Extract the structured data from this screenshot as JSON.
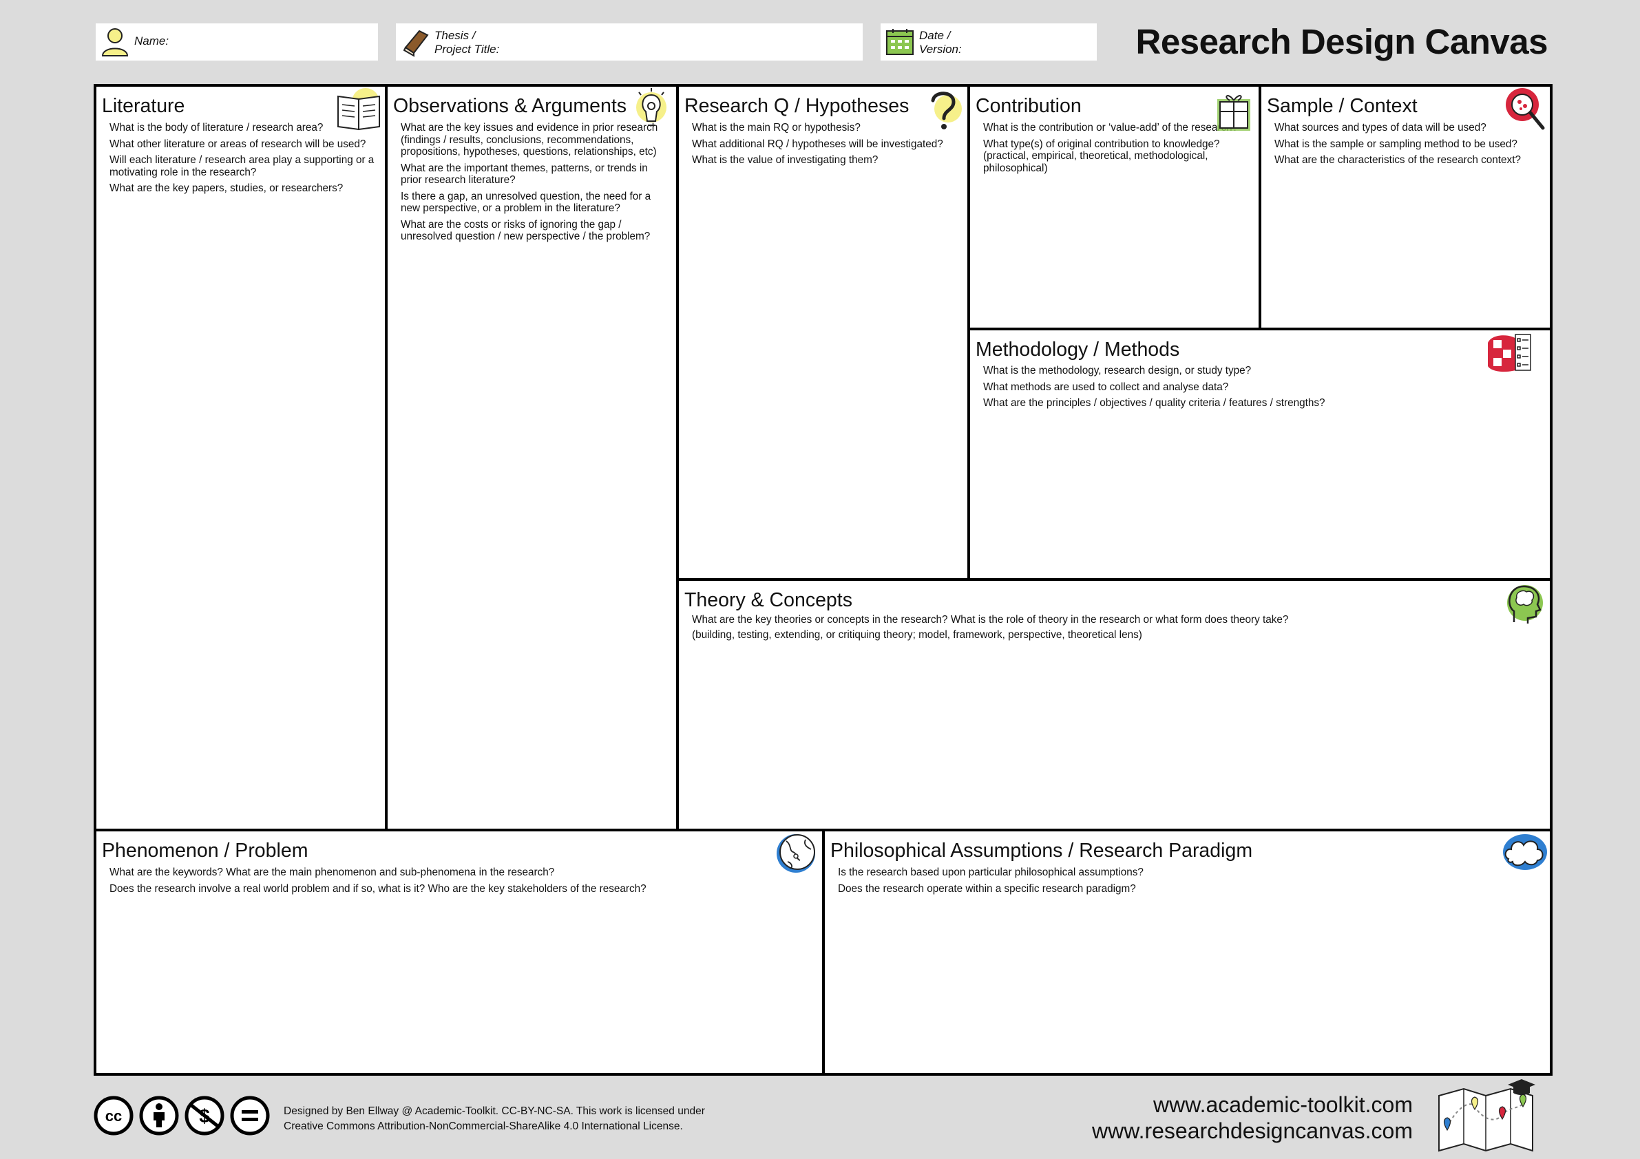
{
  "header": {
    "name_label": "Name:",
    "thesis_label": "Thesis /\nProject Title:",
    "date_label": "Date /\nVersion:",
    "title": "Research Design Canvas"
  },
  "sections": {
    "literature": {
      "title": "Literature",
      "icon": "book-icon",
      "questions": [
        "What is the body of literature / research area?",
        "What other literature or areas of research will be used?",
        "Will each literature / research area play a supporting or a motivating role in the research?",
        "What are the key papers, studies, or researchers?"
      ]
    },
    "observations": {
      "title": "Observations & Arguments",
      "icon": "lightbulb-icon",
      "questions": [
        "What are the key issues and evidence in prior research (findings / results, conclusions, recommendations, propositions, hypotheses, questions, relationships, etc)",
        "What are the important themes, patterns, or trends in prior research literature?",
        "Is there a gap, an unresolved question, the need for a new perspective, or a problem in the literature?",
        "What are the costs or risks of ignoring the gap / unresolved question / new perspective / the problem?"
      ]
    },
    "research_q": {
      "title": "Research Q / Hypotheses",
      "icon": "question-mark-icon",
      "questions": [
        "What is the main RQ or hypothesis?",
        "What additional RQ / hypotheses will be investigated?",
        "What is the value of investigating them?"
      ]
    },
    "contribution": {
      "title": "Contribution",
      "icon": "gift-icon",
      "questions": [
        "What is the contribution or ‘value-add’ of the research?",
        "What type(s) of original contribution to knowledge? (practical,  empirical, theoretical, methodological, philosophical)"
      ]
    },
    "sample": {
      "title": "Sample / Context",
      "icon": "magnifier-icon",
      "questions": [
        "What sources and types of data will be used?",
        "What is the sample or sampling method to be used?",
        "What are the characteristics of the research context?"
      ]
    },
    "methodology": {
      "title": "Methodology / Methods",
      "icon": "checklist-icon",
      "questions": [
        "What is the methodology, research design, or study type?",
        "What methods are used to collect and analyse data?",
        "What are the principles / objectives / quality criteria / features / strengths?"
      ]
    },
    "theory": {
      "title": "Theory & Concepts",
      "icon": "head-brain-icon",
      "questions": [
        "What are the key theories or concepts in the research?  What is the role of theory in the research or what form does theory take?",
        "(building, testing, extending, or critiquing theory; model, framework, perspective, theoretical lens)"
      ]
    },
    "phenomenon": {
      "title": "Phenomenon / Problem",
      "icon": "globe-icon",
      "questions": [
        "What are the keywords?  What are the main phenomenon and sub-phenomena in the research?",
        "Does the research involve a real world problem and if so, what is it?  Who are the key stakeholders of the research?"
      ]
    },
    "philosophical": {
      "title": "Philosophical Assumptions / Research Paradigm",
      "icon": "cloud-icon",
      "questions": [
        "Is the research based upon particular philosophical assumptions?",
        "Does the research operate within a specific research paradigm?"
      ]
    }
  },
  "footer": {
    "license_line1": "Designed by Ben Ellway @ Academic-Toolkit. CC-BY-NC-SA. This work is licensed under",
    "license_line2": "Creative Commons Attribution-NonCommercial-ShareAlike 4.0 International License.",
    "cc_icons": [
      "cc-icon",
      "by-icon",
      "nc-icon",
      "sa-icon"
    ],
    "cc_text": "cc",
    "url1": "www.academic-toolkit.com",
    "url2": "www.researchdesigncanvas.com"
  },
  "colors": {
    "background": "#dcdcdc",
    "border": "#000000",
    "name_icon": "#f6f08a",
    "date_icon": "#8cc751",
    "accent_red": "#d7263d",
    "accent_green": "#8cc751",
    "accent_blue": "#2f7fd1",
    "accent_yellow": "#f6f08a"
  }
}
